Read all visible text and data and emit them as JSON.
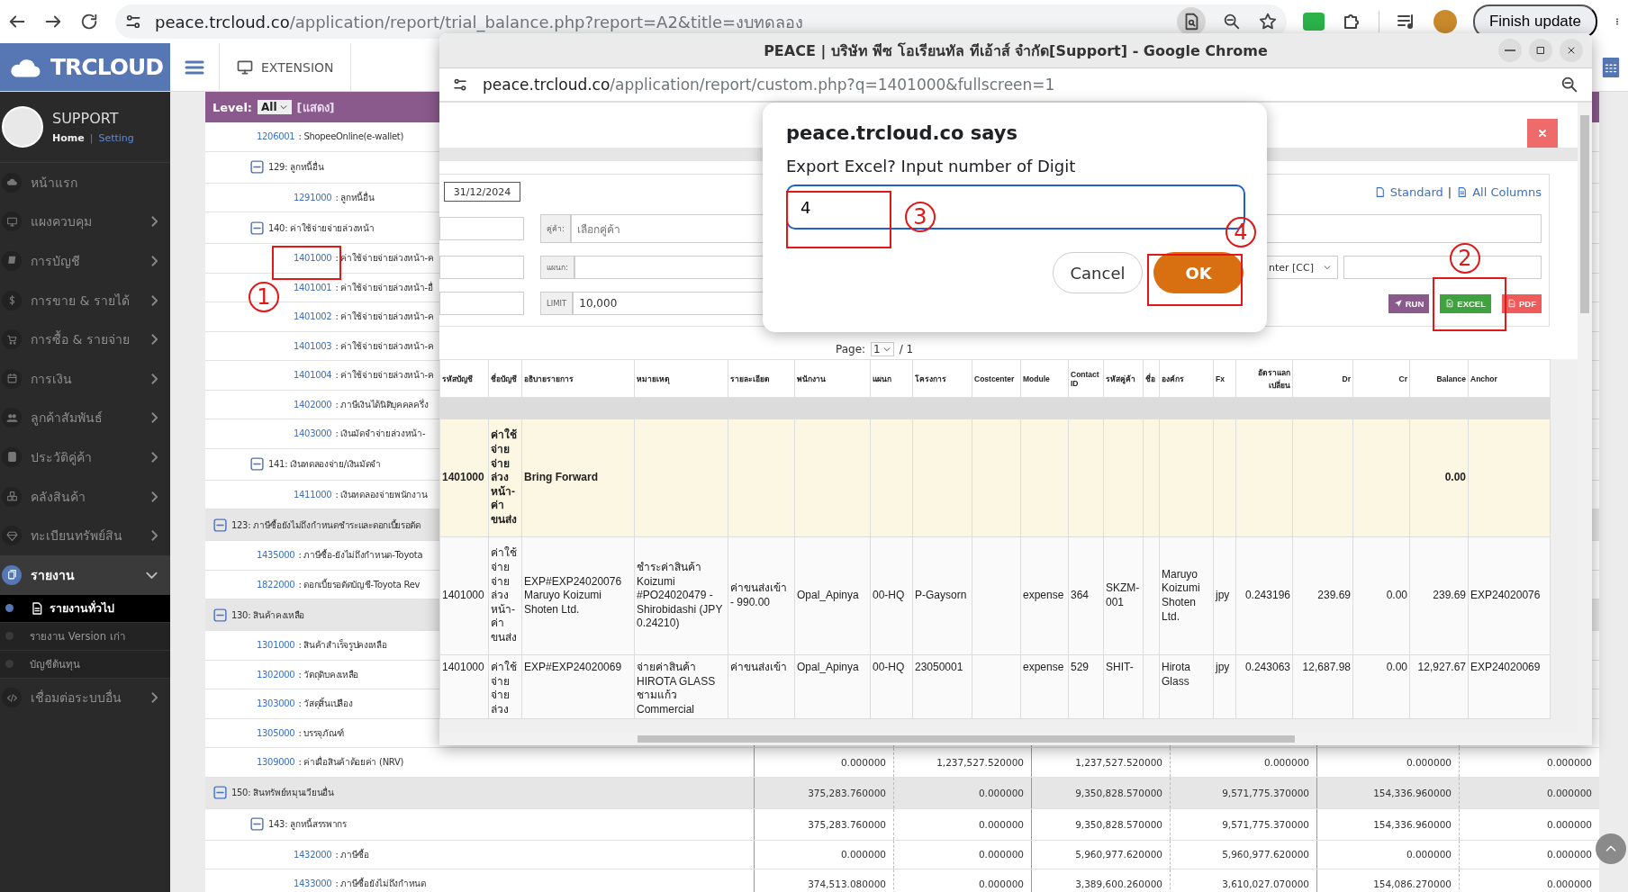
{
  "browser": {
    "url_host": "peace.trcloud.co",
    "url_path": "/application/report/trial_balance.php?report=A2&title=งบทดลอง",
    "update_button": "Finish update"
  },
  "app_header": {
    "logo": "TRCLOUD",
    "extension": "EXTENSION"
  },
  "sidebar": {
    "user": {
      "name": "SUPPORT",
      "home_link": "Home",
      "separator": "|",
      "setting_link": "Setting"
    },
    "items": [
      {
        "label": "หน้าแรก",
        "kind": "link",
        "selected": false
      },
      {
        "label": "แผงควบคุม",
        "kind": "menu",
        "expanded": false,
        "selected": false
      },
      {
        "label": "การบัญชี",
        "kind": "menu",
        "expanded": false,
        "selected": false
      },
      {
        "label": "การขาย & รายได้",
        "kind": "menu",
        "expanded": false,
        "selected": false
      },
      {
        "label": "การซื้อ & รายจ่าย",
        "kind": "menu",
        "expanded": false,
        "selected": false
      },
      {
        "label": "การเงิน",
        "kind": "menu",
        "expanded": false,
        "selected": false
      },
      {
        "label": "ลูกค้าสัมพันธ์",
        "kind": "menu",
        "expanded": false,
        "selected": false
      },
      {
        "label": "ประวัติคู่ค้า",
        "kind": "menu",
        "expanded": false,
        "selected": false
      },
      {
        "label": "คลังสินค้า",
        "kind": "menu",
        "expanded": false,
        "selected": false
      },
      {
        "label": "ทะเบียนทรัพย์สิน",
        "kind": "menu",
        "expanded": false,
        "selected": false
      },
      {
        "label": "รายงาน",
        "kind": "menu",
        "expanded": true,
        "selected": true,
        "children": [
          {
            "label": "รายงานทั่วไป",
            "selected": true
          },
          {
            "label": "รายงาน Version เก่า",
            "selected": false
          },
          {
            "label": "บัญชีต้นทุน",
            "selected": false
          }
        ]
      },
      {
        "label": "เชื่อมต่อระบบอื่น",
        "kind": "menu",
        "expanded": false,
        "selected": false
      }
    ]
  },
  "level_bar": {
    "label": "Level:",
    "select": "All",
    "show_link": "[แสดง]"
  },
  "tree": [
    {
      "kind": "continued",
      "children": [
        {
          "kind": "leaf",
          "code": "1206001",
          "name": ": ShopeeOnline(e-wallet)"
        },
        {
          "kind": "group",
          "label": "129: ลูกหนี้อื่น",
          "children": [
            {
              "kind": "leaf",
              "code": "1291000",
              "name": ": ลูกหนี้อื่น"
            }
          ]
        },
        {
          "kind": "group",
          "label": "140: ค่าใช้จ่ายจ่ายล่วงหน้า",
          "children": [
            {
              "kind": "leaf",
              "code": "1401000",
              "name": ": ค่าใช้จ่ายจ่ายล่วงหน้า-ค"
            },
            {
              "kind": "leaf",
              "code": "1401001",
              "name": ": ค่าใช้จ่ายจ่ายล่วงหน้า-อื่"
            },
            {
              "kind": "leaf",
              "code": "1401002",
              "name": ": ค่าใช้จ่ายจ่ายล่วงหน้า-ค"
            },
            {
              "kind": "leaf",
              "code": "1401003",
              "name": ": ค่าใช้จ่ายจ่ายล่วงหน้า-ค"
            },
            {
              "kind": "leaf",
              "code": "1401004",
              "name": ": ค่าใช้จ่ายจ่ายล่วงหน้า-ค"
            },
            {
              "kind": "leaf",
              "code": "1402000",
              "name": ": ภาษีเงินได้นิติบุคคลครึ่ง"
            },
            {
              "kind": "leaf",
              "code": "1403000",
              "name": ": เงินมัดจำจ่ายล่วงหน้า-"
            }
          ]
        },
        {
          "kind": "group",
          "label": "141: เงินทดลองจ่าย/เงินมัดจำ",
          "children": [
            {
              "kind": "leaf",
              "code": "1411000",
              "name": ": เงินทดลองจ่ายพนักงาน"
            }
          ]
        }
      ]
    },
    {
      "kind": "group",
      "label": "123: ภาษีซื้อยังไม่ถึงกำหนดชำระและดอกเบี้ยรอตัด",
      "children": [
        {
          "kind": "leaf",
          "code": "1435000",
          "name": ": ภาษีซื้อ-ยังไม่ถึงกำหนด-Toyota"
        },
        {
          "kind": "leaf",
          "code": "1822000",
          "name": ": ดอกเบี้ยรอตัดบัญชี-Toyota Rev"
        }
      ]
    },
    {
      "kind": "group",
      "label": "130: สินค้าคงเหลือ",
      "children": [
        {
          "kind": "leaf",
          "code": "1301000",
          "name": ": สินค้าสำเร็จรูปคงเหลือ"
        },
        {
          "kind": "leaf",
          "code": "1302000",
          "name": ": วัตถุดิบคงเหลือ"
        },
        {
          "kind": "leaf",
          "code": "1303000",
          "name": ": วัสดุสิ้นเปลือง"
        },
        {
          "kind": "leaf",
          "code": "1305000",
          "name": ": บรรจุภัณฑ์"
        },
        {
          "kind": "leaf",
          "code": "1309000",
          "name": ": ค่าเผื่อสินค้าด้อยค่า (NRV)",
          "values": [
            "0.000000",
            "1,237,527.520000",
            "1,237,527.520000",
            "0.000000",
            "0.000000",
            "0.000000"
          ]
        }
      ]
    },
    {
      "kind": "group",
      "label": "150: สินทรัพย์หมุนเวียนอื่น",
      "values": [
        "375,283.760000",
        "0.000000",
        "9,350,828.570000",
        "9,571,775.370000",
        "154,336.960000",
        "0.000000"
      ],
      "children": [
        {
          "kind": "group",
          "label": "143: ลูกหนี้สรรพากร",
          "values": [
            "375,283.760000",
            "0.000000",
            "9,350,828.570000",
            "9,571,775.370000",
            "154,336.960000",
            "0.000000"
          ],
          "children": [
            {
              "kind": "leaf",
              "code": "1432000",
              "name": ": ภาษีซื้อ",
              "values": [
                "0.000000",
                "0.000000",
                "5,960,977.620000",
                "5,960,977.620000",
                "0.000000",
                "0.000000"
              ]
            },
            {
              "kind": "leaf",
              "code": "1433000",
              "name": ": ภาษีซื้อยังไม่ถึงกำหนด",
              "values": [
                "374,513.080000",
                "0.000000",
                "3,389,600.260000",
                "3,610,027.070000",
                "154,086.270000",
                "0.000000"
              ]
            }
          ]
        }
      ]
    }
  ],
  "popup": {
    "title": "PEACE | บริษัท พีซ โอเรียนทัล ทีเอ้าส์ จำกัด[Support] - Google Chrome",
    "url_host": "peace.trcloud.co",
    "url_path": "/application/report/custom.php?q=1401000&fullscreen=1",
    "report": {
      "date": "31/12/2024",
      "standard_link": "Standard",
      "separator": "|",
      "all_columns_link": "All Columns",
      "partner_label": "คู่ค้า:",
      "partner_placeholder": "เลือกคู่ค้า",
      "department_label": "แผนก:",
      "costcenter_select": "nter [CC]",
      "limit_label": "LIMIT",
      "limit_value": "10,000",
      "buttons": [
        {
          "label": "RUN",
          "kind": "run"
        },
        {
          "label": "EXCEL",
          "kind": "excel"
        },
        {
          "label": "PDF",
          "kind": "pdf"
        }
      ],
      "page_label": "Page:",
      "page_value": "1",
      "page_total": "/ 1"
    },
    "table": {
      "columns": [
        "รหัสบัญชี",
        "ชื่อบัญชี",
        "อธิบายรายการ",
        "หมายเหตุ",
        "รายละเอียด",
        "พนักงาน",
        "แผนก",
        "โครงการ",
        "Costcenter",
        "Module",
        "Contact ID",
        "รหัสคู่ค้า",
        "ชื่อ",
        "องค์กร",
        "Fx",
        "อัตราแลกเปลี่ยน",
        "Dr",
        "Cr",
        "Balance",
        "Anchor"
      ],
      "rows": [
        {
          "kind": "bring-forward",
          "cells": [
            "1401000",
            "ค่าใช้จ่ายจ่ายล่วงหน้า-ค่าขนส่ง",
            "Bring Forward",
            null,
            null,
            null,
            null,
            null,
            null,
            null,
            null,
            null,
            null,
            null,
            null,
            null,
            null,
            null,
            "0.00",
            null
          ]
        },
        {
          "kind": "entry",
          "cells": [
            "1401000",
            "ค่าใช้จ่ายจ่ายล่วงหน้า-ค่าขนส่ง",
            "EXP#EXP24020076 Maruyo Koizumi Shoten Ltd.",
            "ชำระค่าสินค้า Koizumi #PO24020479 - Shirobidashi (JPY 0.24210)",
            "ค่าขนส่งเข้า - 990.00",
            "Opal_Apinya",
            "00-HQ",
            "P-Gaysorn",
            null,
            "expense",
            "364",
            "SKZM-001",
            null,
            "Maruyo Koizumi Shoten Ltd.",
            "jpy",
            "0.243196",
            "239.69",
            "0.00",
            "239.69",
            "EXP24020076"
          ]
        },
        {
          "kind": "partial",
          "cells": [
            "1401000",
            "ค่าใช้จ่ายจ่ายล่วง",
            "EXP#EXP24020069",
            "จ่ายค่าสินค้า HIROTA GLASS ชามแก้ว Commercial",
            "ค่าขนส่งเข้า",
            "Opal_Apinya",
            "00-HQ",
            "23050001",
            null,
            "expense",
            "529",
            "SHIT-",
            null,
            "Hirota Glass",
            "jpy",
            "0.243063",
            "12,687.98",
            "0.00",
            "12,927.67",
            "EXP24020069"
          ]
        }
      ]
    },
    "dialog": {
      "title": "peace.trcloud.co says",
      "message": "Export Excel? Input number of Digit",
      "value": "4",
      "cancel": "Cancel",
      "ok": "OK"
    }
  },
  "annotations": [
    {
      "label": "1"
    },
    {
      "label": "2"
    },
    {
      "label": "3"
    },
    {
      "label": "4"
    }
  ]
}
